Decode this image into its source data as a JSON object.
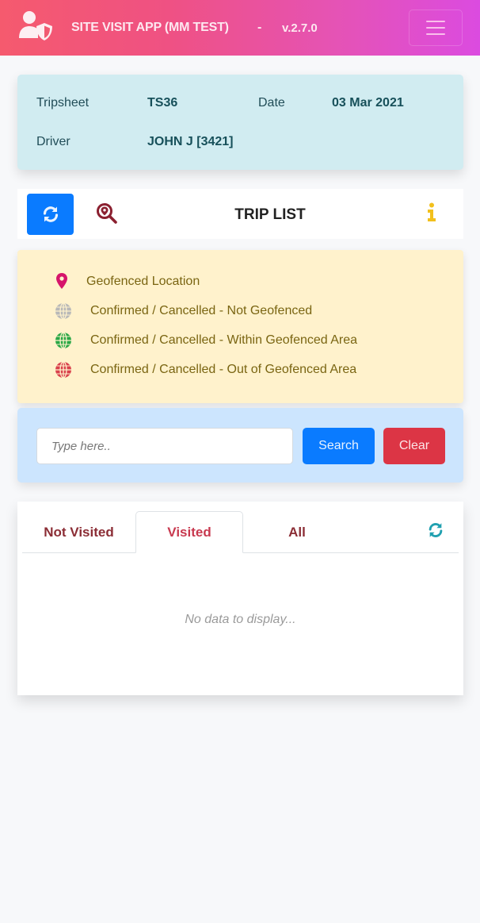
{
  "header": {
    "app_title": "SITE VISIT APP (MM TEST)",
    "separator": "-",
    "version": "v.2.7.0",
    "brand_icon": "user-shield-icon",
    "menu_icon": "hamburger-menu-icon"
  },
  "tripsheet_info": {
    "tripsheet_label": "Tripsheet",
    "tripsheet_value": "TS36",
    "date_label": "Date",
    "date_value": "03 Mar 2021",
    "driver_label": "Driver",
    "driver_value": "JOHN J [3421]"
  },
  "toolbar": {
    "title": "TRIP LIST",
    "refresh_icon": "sync-icon",
    "search_location_icon": "search-location-icon",
    "info_icon": "info-icon"
  },
  "legend": {
    "items": [
      {
        "icon": "map-marker-icon",
        "color": "#d6156b",
        "label": "Geofenced Location"
      },
      {
        "icon": "globe-icon",
        "color": "#b8b8b8",
        "label": "Confirmed / Cancelled - Not Geofenced"
      },
      {
        "icon": "globe-icon",
        "color": "#28a745",
        "label": "Confirmed / Cancelled - Within Geofenced Area"
      },
      {
        "icon": "globe-icon",
        "color": "#d9414c",
        "label": "Confirmed / Cancelled - Out of Geofenced Area"
      }
    ]
  },
  "search": {
    "value": "",
    "placeholder": "Type here..",
    "search_label": "Search",
    "clear_label": "Clear"
  },
  "trip_list": {
    "tabs": [
      {
        "label": "Not Visited",
        "active": false
      },
      {
        "label": "Visited",
        "active": true
      },
      {
        "label": "All",
        "active": false
      }
    ],
    "empty_message": "No data to display..."
  },
  "colors": {
    "primary": "#0a7bff",
    "danger": "#dc3545",
    "info_bg": "#d1ecf1",
    "warning_bg": "#fff2cc",
    "search_bg": "#cce5fe",
    "tab_text": "#8b2d35",
    "tab_active_text": "#c8394f",
    "refresh_teal": "#20a0b0"
  }
}
